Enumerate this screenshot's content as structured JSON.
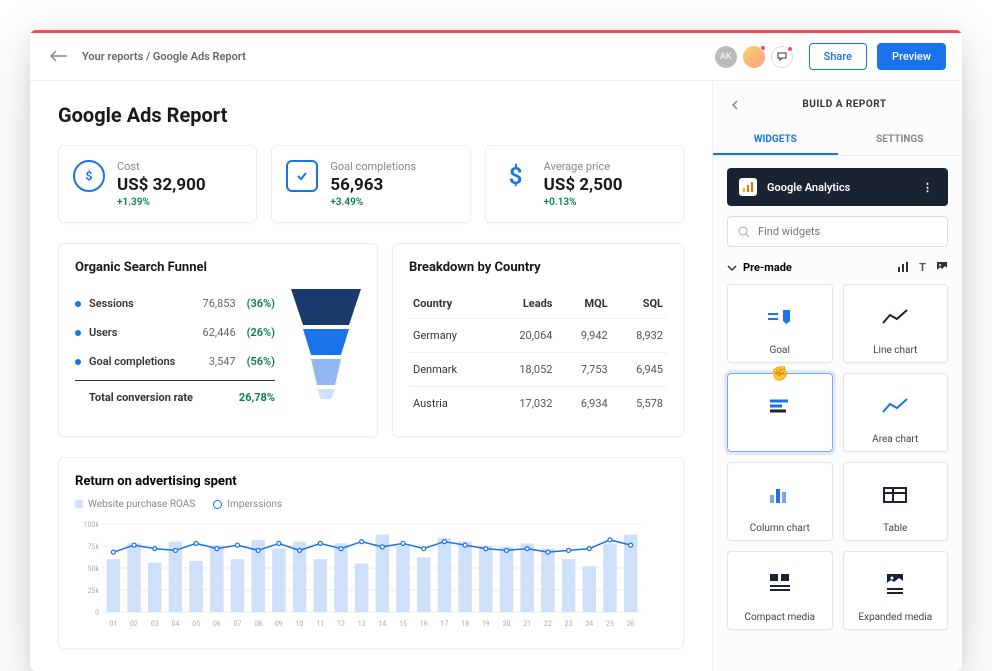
{
  "breadcrumb": "Your reports / Google Ads Report",
  "header": {
    "share": "Share",
    "preview": "Preview",
    "avatar1": "AK"
  },
  "title": "Google Ads Report",
  "kpis": [
    {
      "label": "Cost",
      "value": "US$ 32,900",
      "delta": "+1.39%"
    },
    {
      "label": "Goal completions",
      "value": "56,963",
      "delta": "+3.49%"
    },
    {
      "label": "Average price",
      "value": "US$ 2,500",
      "delta": "+0.13%"
    }
  ],
  "funnel": {
    "title": "Organic Search Funnel",
    "rows": [
      {
        "name": "Sessions",
        "num": "76,853",
        "pct": "(36%)"
      },
      {
        "name": "Users",
        "num": "62,446",
        "pct": "(26%)"
      },
      {
        "name": "Goal completions",
        "num": "3,547",
        "pct": "(56%)"
      }
    ],
    "total_label": "Total conversion rate",
    "total_pct": "26,78%"
  },
  "country": {
    "title": "Breakdown by Country",
    "cols": [
      "Country",
      "Leads",
      "MQL",
      "SQL"
    ],
    "rows": [
      [
        "Germany",
        "20,064",
        "9,942",
        "8,932"
      ],
      [
        "Denmark",
        "18,052",
        "7,753",
        "6,945"
      ],
      [
        "Austria",
        "17,032",
        "6,934",
        "5,578"
      ]
    ]
  },
  "roas": {
    "title": "Return on advertising spent",
    "legend": [
      "Website purchase ROAS",
      "Imperssions"
    ]
  },
  "chart_data": {
    "type": "bar",
    "title": "Return on advertising spent",
    "ylabel": "",
    "ylim": [
      0,
      100
    ],
    "yticks": [
      0,
      25,
      50,
      75,
      100
    ],
    "ytick_labels": [
      "0",
      "25k",
      "50k",
      "75k",
      "100k"
    ],
    "categories": [
      "01",
      "02",
      "03",
      "04",
      "05",
      "06",
      "07",
      "08",
      "09",
      "10",
      "11",
      "12",
      "13",
      "14",
      "15",
      "16",
      "17",
      "18",
      "19",
      "20",
      "21",
      "22",
      "23",
      "24",
      "25",
      "26"
    ],
    "series": [
      {
        "name": "Website purchase ROAS",
        "type": "bar",
        "values": [
          60,
          78,
          56,
          80,
          58,
          76,
          60,
          82,
          72,
          80,
          60,
          78,
          55,
          88,
          75,
          62,
          84,
          80,
          75,
          74,
          78,
          72,
          60,
          52,
          78,
          88
        ]
      },
      {
        "name": "Imperssions",
        "type": "line",
        "values": [
          68,
          76,
          72,
          70,
          78,
          72,
          76,
          70,
          78,
          70,
          78,
          72,
          80,
          74,
          78,
          72,
          80,
          76,
          72,
          70,
          72,
          68,
          70,
          72,
          82,
          76
        ]
      }
    ]
  },
  "side": {
    "title": "BUILD A REPORT",
    "tabs": [
      "WIDGETS",
      "SETTINGS"
    ],
    "datasource": "Google Analytics",
    "search_placeholder": "Find widgets",
    "section": "Pre-made",
    "widgets": [
      "Goal",
      "Line chart",
      "",
      "Area chart",
      "Column chart",
      "Table",
      "Compact media",
      "Expanded media"
    ]
  }
}
